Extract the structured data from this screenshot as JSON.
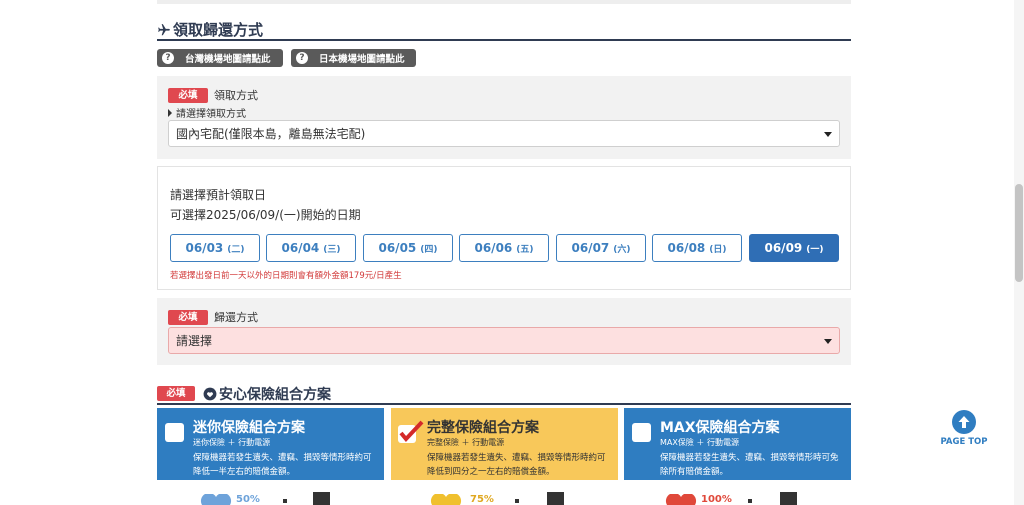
{
  "pickup_section": {
    "title": "領取歸還方式",
    "map_buttons": [
      "台灣機場地圖請點此",
      "日本機場地圖請點此"
    ],
    "required_label": "必填",
    "pickup_label": "領取方式",
    "pickup_hint": "請選擇領取方式",
    "pickup_value": "國內宅配(僅限本島，離島無法宅配)"
  },
  "date_section": {
    "heading": "請選擇預計領取日",
    "available": "可選擇2025/06/09/(一)開始的日期",
    "dates": [
      {
        "date": "06/03",
        "dow": "(二)"
      },
      {
        "date": "06/04",
        "dow": "(三)"
      },
      {
        "date": "06/05",
        "dow": "(四)"
      },
      {
        "date": "06/06",
        "dow": "(五)"
      },
      {
        "date": "06/07",
        "dow": "(六)"
      },
      {
        "date": "06/08",
        "dow": "(日)"
      },
      {
        "date": "06/09",
        "dow": "(一)"
      }
    ],
    "selected_index": 6,
    "note": "若選擇出發日前一天以外的日期則會有額外金額179元/日產生"
  },
  "return_section": {
    "required_label": "必填",
    "label": "歸還方式",
    "placeholder": "請選擇"
  },
  "insurance": {
    "required_label": "必填",
    "title": "安心保險組合方案",
    "plans": [
      {
        "title": "迷你保險組合方案",
        "sub": "迷你保險 ＋ 行動電源",
        "desc": "保障機器若發生遺失、遭竊、損毀等情形時約可降低一半左右的賠償金額。",
        "percent": "50%",
        "checked": false,
        "color": "#2f7dc1"
      },
      {
        "title": "完整保險組合方案",
        "sub": "完整保險 ＋ 行動電源",
        "desc": "保障機器若發生遺失、遭竊、損毀等情形時約可降低到四分之一左右的賠償金額。",
        "percent": "75%",
        "checked": true,
        "color": "#f8c85a"
      },
      {
        "title": "MAX保險組合方案",
        "sub": "MAX保險 ＋ 行動電源",
        "desc": "保障機器若發生遺失、遭竊、損毀等情形時可免除所有賠償金額。",
        "percent": "100%",
        "checked": false,
        "color": "#2f7dc1"
      }
    ]
  },
  "page_top": "PAGE TOP"
}
